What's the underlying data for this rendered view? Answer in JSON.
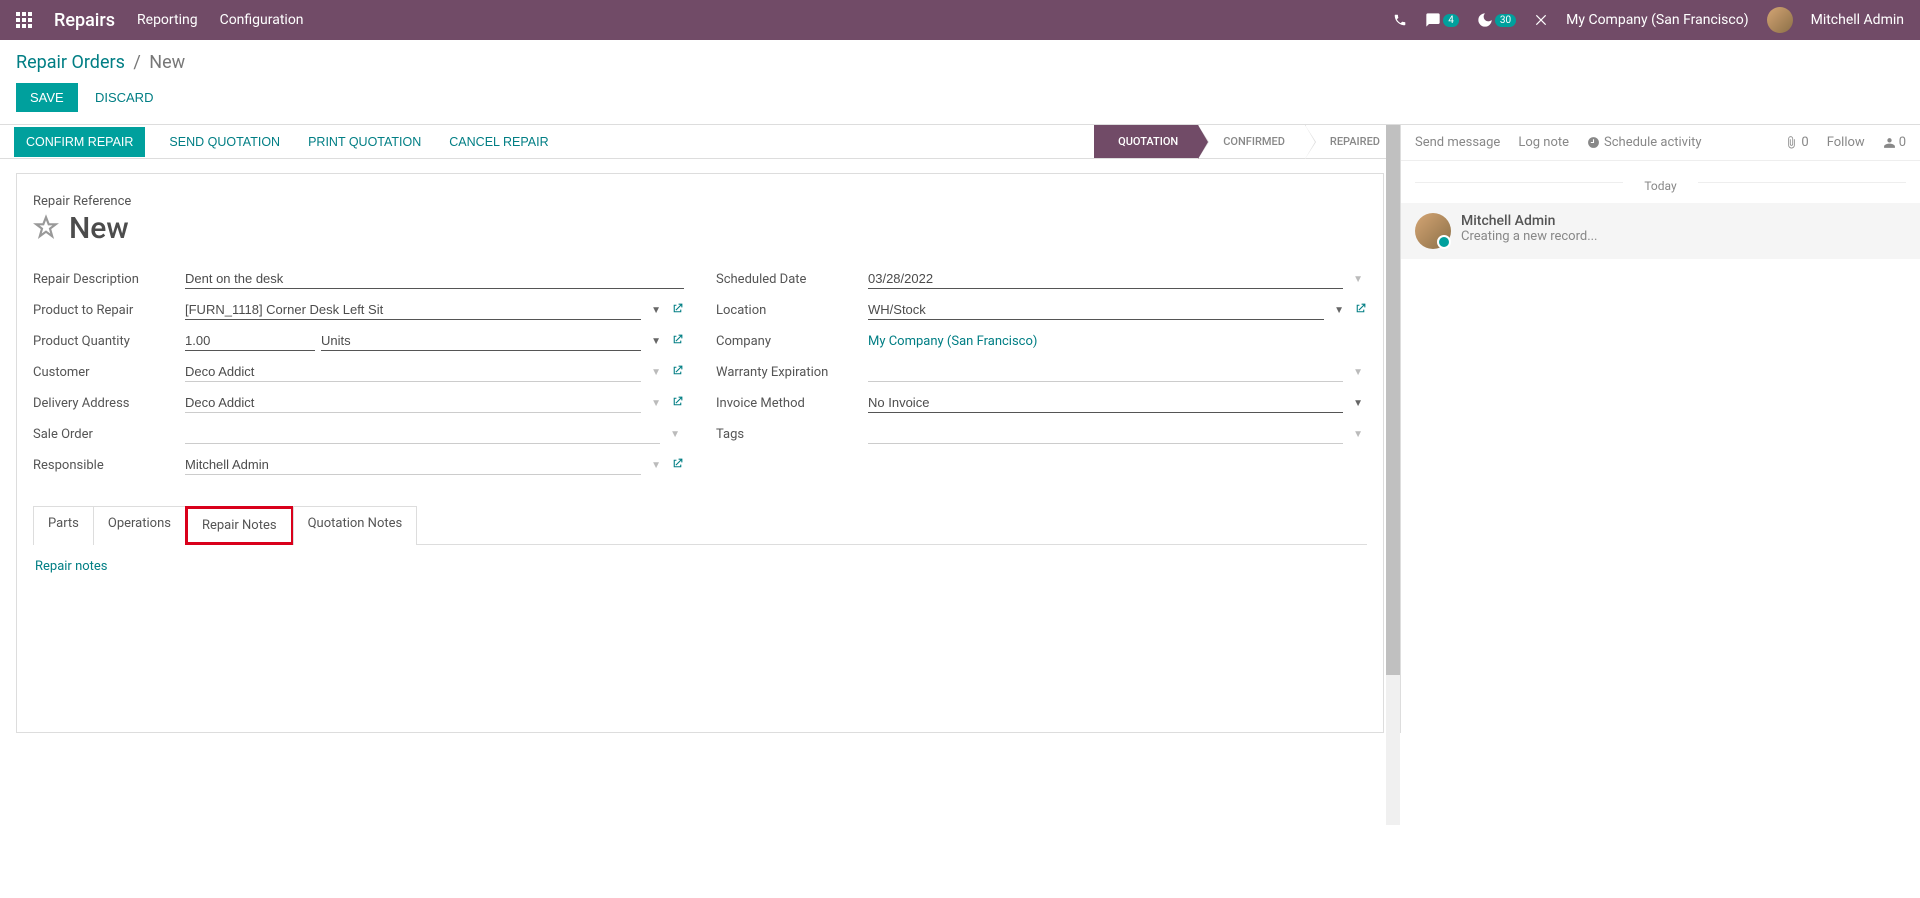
{
  "navbar": {
    "app": "Repairs",
    "links": [
      "Reporting",
      "Configuration"
    ],
    "chat_badge": "4",
    "activity_badge": "30",
    "company": "My Company (San Francisco)",
    "user": "Mitchell Admin"
  },
  "breadcrumb": {
    "root": "Repair Orders",
    "current": "New"
  },
  "actions": {
    "save": "SAVE",
    "discard": "DISCARD"
  },
  "status_buttons": {
    "confirm": "CONFIRM REPAIR",
    "send_quote": "SEND QUOTATION",
    "print_quote": "PRINT QUOTATION",
    "cancel": "CANCEL REPAIR"
  },
  "status_chain": {
    "quotation": "QUOTATION",
    "confirmed": "CONFIRMED",
    "repaired": "REPAIRED"
  },
  "form": {
    "ref_label": "Repair Reference",
    "ref_value": "New",
    "left": {
      "desc_label": "Repair Description",
      "desc_value": "Dent on the desk",
      "product_label": "Product to Repair",
      "product_value": "[FURN_1118] Corner Desk Left Sit",
      "qty_label": "Product Quantity",
      "qty_value": "1.00",
      "qty_unit": "Units",
      "customer_label": "Customer",
      "customer_value": "Deco Addict",
      "delivery_label": "Delivery Address",
      "delivery_value": "Deco Addict",
      "sale_label": "Sale Order",
      "sale_value": "",
      "responsible_label": "Responsible",
      "responsible_value": "Mitchell Admin"
    },
    "right": {
      "sched_label": "Scheduled Date",
      "sched_value": "03/28/2022",
      "location_label": "Location",
      "location_value": "WH/Stock",
      "company_label": "Company",
      "company_value": "My Company (San Francisco)",
      "warranty_label": "Warranty Expiration",
      "warranty_value": "",
      "invoice_label": "Invoice Method",
      "invoice_value": "No Invoice",
      "tags_label": "Tags",
      "tags_value": ""
    }
  },
  "tabs": {
    "parts": "Parts",
    "operations": "Operations",
    "repair_notes": "Repair Notes",
    "quotation_notes": "Quotation Notes"
  },
  "tab_content": {
    "placeholder": "Repair notes"
  },
  "chatter": {
    "send": "Send message",
    "log": "Log note",
    "schedule": "Schedule activity",
    "attach_count": "0",
    "follow": "Follow",
    "follower_count": "0",
    "today": "Today",
    "msg_author": "Mitchell Admin",
    "msg_text": "Creating a new record..."
  }
}
